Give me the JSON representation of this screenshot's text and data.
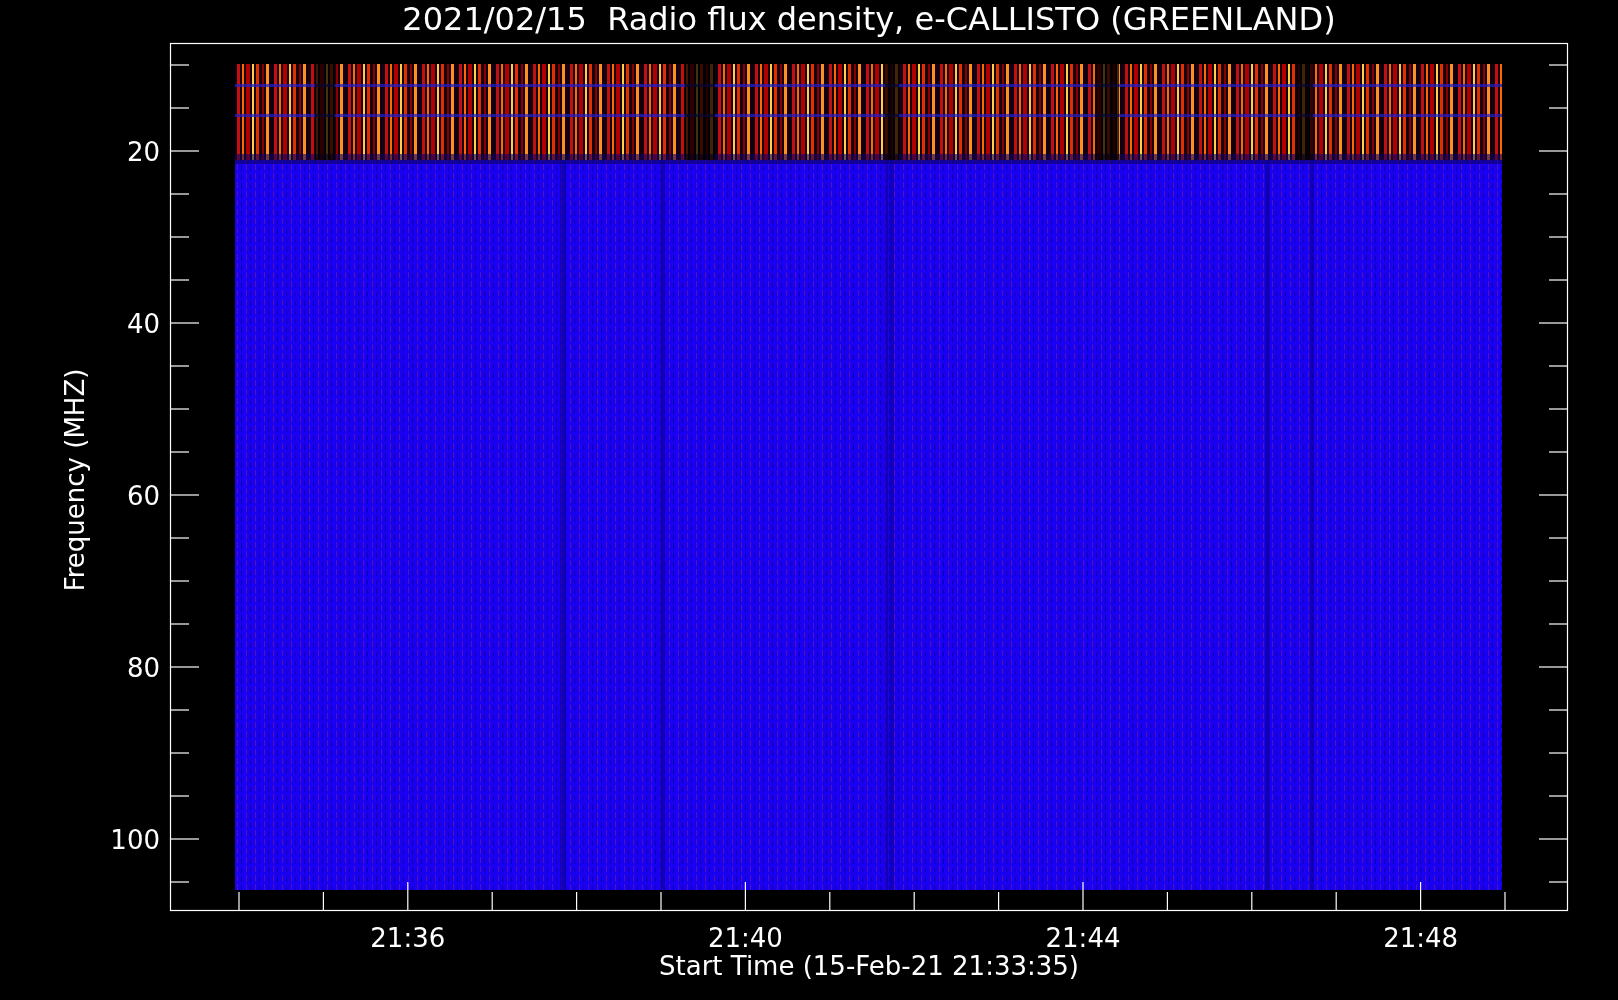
{
  "title": "2021/02/15  Radio flux density, e-CALLISTO (GREENLAND)",
  "y_axis": {
    "title": "Frequency (MHZ)",
    "tick_labels": [
      "20",
      "40",
      "60",
      "80",
      "100"
    ]
  },
  "x_axis": {
    "title": "Start Time (15-Feb-21 21:33:35)",
    "tick_labels": [
      "21:36",
      "21:40",
      "21:44",
      "21:48"
    ]
  }
}
